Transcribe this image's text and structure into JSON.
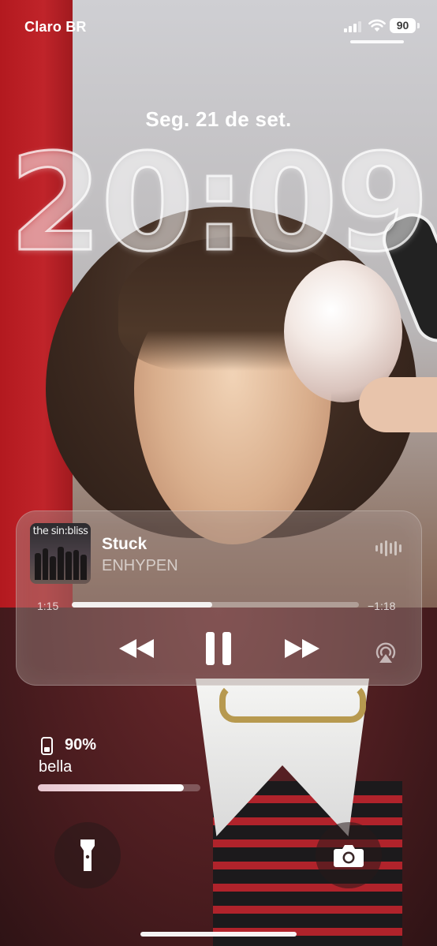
{
  "status_bar": {
    "carrier": "Claro BR",
    "battery_level": "90",
    "icons": [
      "cellular-signal-icon",
      "wifi-icon",
      "battery-icon"
    ]
  },
  "lock_screen": {
    "date": "Seg. 21 de set.",
    "time": "20:09"
  },
  "now_playing": {
    "album_art_text": "the sin:bliss",
    "title": "Stuck",
    "artist": "ENHYPEN",
    "elapsed": "1:15",
    "remaining": "−1:18",
    "progress_fraction": 0.49,
    "controls": [
      "rewind-icon",
      "pause-icon",
      "fast-forward-icon",
      "airplay-icon"
    ]
  },
  "battery_widget": {
    "percent": "90%",
    "device_name": "bella",
    "level_fraction": 0.9,
    "icon": "iphone-icon"
  },
  "quick_actions": {
    "left": "flashlight-icon",
    "right": "camera-icon"
  },
  "colors": {
    "widget_fill": "#a08c87",
    "text_primary": "#ffffff",
    "wallpaper_red": "#b3191f",
    "battery_bar_start": "#e8c5cf"
  }
}
